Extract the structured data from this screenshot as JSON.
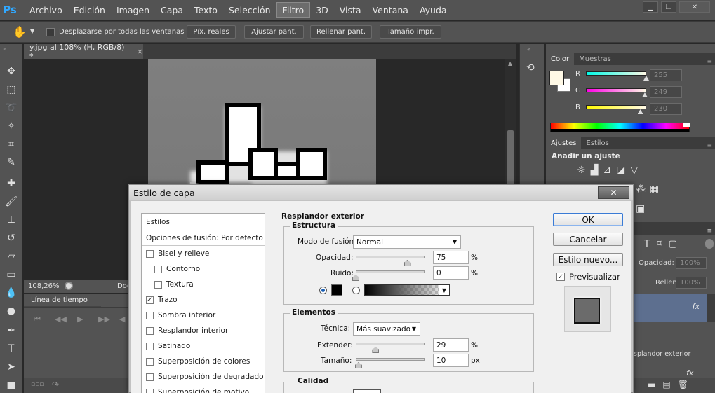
{
  "app": {
    "logo": "Ps"
  },
  "menubar": {
    "items": [
      "Archivo",
      "Edición",
      "Imagen",
      "Capa",
      "Texto",
      "Selección",
      "Filtro",
      "3D",
      "Vista",
      "Ventana",
      "Ayuda"
    ],
    "active": "Filtro"
  },
  "options_bar": {
    "tool_icon": "hand-icon",
    "checkbox_label": "Desplazarse por todas las ventanas",
    "buttons": [
      "Píx. reales",
      "Ajustar pant.",
      "Rellenar pant.",
      "Tamaño impr."
    ]
  },
  "document": {
    "tab_title": "y.jpg al 108% (H, RGB/8) *",
    "close_symbol": "×",
    "zoom_status": "108,26%",
    "doc_label": "Doc"
  },
  "timeline": {
    "title": "Línea de tiempo"
  },
  "right_panel": {
    "color_tabs": [
      "Color",
      "Muestras"
    ],
    "channels": [
      {
        "name": "R",
        "value": "255",
        "color": "#ff0000"
      },
      {
        "name": "G",
        "value": "249",
        "color": "#00ff00"
      },
      {
        "name": "B",
        "value": "230",
        "color": "#0000ff"
      }
    ],
    "foreground_color": "#fff9e6",
    "adjust_tabs": [
      "Ajustes",
      "Estilos"
    ],
    "adjust_title": "Añadir un ajuste",
    "layers_partial": {
      "opacity_label": "Opacidad:",
      "opacity_value": "100%",
      "fill_label": "Relleno:",
      "fill_value": "100%",
      "fx_label": "fx",
      "effect_label": "splandor exterior"
    }
  },
  "dialog": {
    "title": "Estilo de capa",
    "close_symbol": "✕",
    "list_header": "Estilos",
    "blend_options": "Opciones de fusión: Por defecto",
    "styles": [
      {
        "label": "Bisel y relieve",
        "checked": false,
        "indent": false
      },
      {
        "label": "Contorno",
        "checked": false,
        "indent": true
      },
      {
        "label": "Textura",
        "checked": false,
        "indent": true
      },
      {
        "label": "Trazo",
        "checked": true,
        "indent": false
      },
      {
        "label": "Sombra interior",
        "checked": false,
        "indent": false
      },
      {
        "label": "Resplandor interior",
        "checked": false,
        "indent": false
      },
      {
        "label": "Satinado",
        "checked": false,
        "indent": false
      },
      {
        "label": "Superposición de colores",
        "checked": false,
        "indent": false
      },
      {
        "label": "Superposición de degradado",
        "checked": false,
        "indent": false
      },
      {
        "label": "Superposición de motivo",
        "checked": false,
        "indent": false
      }
    ],
    "section_title": "Resplandor exterior",
    "structure": {
      "title": "Estructura",
      "blend_mode_label": "Modo de fusión:",
      "blend_mode": "Normal",
      "opacity_label": "Opacidad:",
      "opacity": "75",
      "opacity_pct": 75,
      "noise_label": "Ruido:",
      "noise": "0",
      "noise_pct": 0,
      "unit": "%"
    },
    "elements": {
      "title": "Elementos",
      "technique_label": "Técnica:",
      "technique": "Más suavizado",
      "spread_label": "Extender:",
      "spread": "29",
      "spread_pct": 29,
      "spread_unit": "%",
      "size_label": "Tamaño:",
      "size": "10",
      "size_pct": 4,
      "size_unit": "px"
    },
    "quality": {
      "title": "Calidad"
    },
    "buttons": {
      "ok": "OK",
      "cancel": "Cancelar",
      "new_style": "Estilo nuevo...",
      "preview": "Previsualizar",
      "preview_checked": true
    }
  }
}
